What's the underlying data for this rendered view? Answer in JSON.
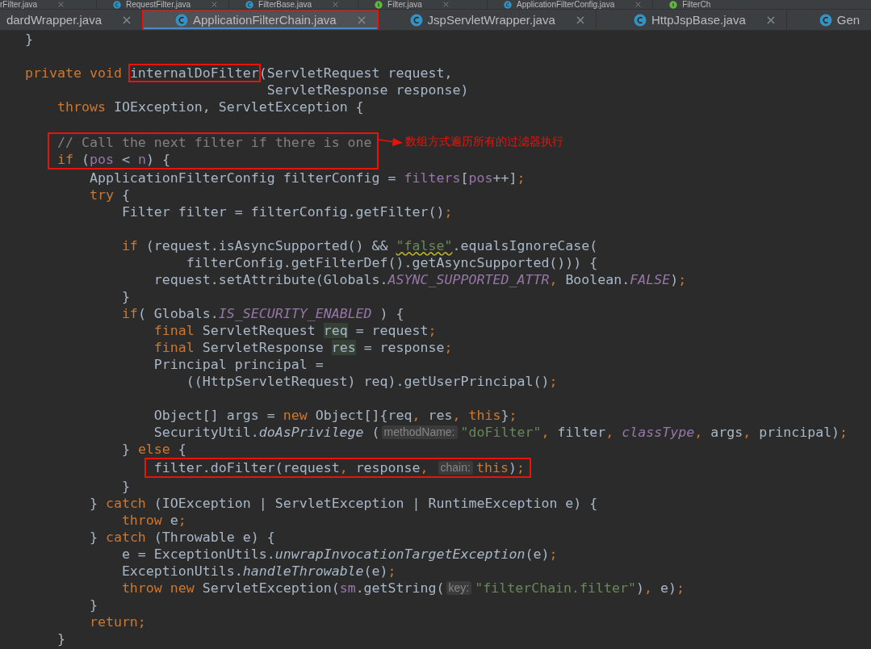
{
  "tab_rows": [
    {
      "tabs": [
        {
          "label": "rFilter.java",
          "kind": "plain",
          "closable": true,
          "selected": false,
          "boxed": false
        },
        {
          "label": "RequestFilter.java",
          "kind": "class",
          "closable": true,
          "selected": false,
          "boxed": false
        },
        {
          "label": "FilterBase.java",
          "kind": "class",
          "closable": true,
          "selected": false,
          "boxed": false
        },
        {
          "label": "Filter.java",
          "kind": "interface",
          "closable": true,
          "selected": false,
          "boxed": false
        },
        {
          "label": "ApplicationFilterConfig.java",
          "kind": "class",
          "closable": true,
          "selected": false,
          "boxed": false
        },
        {
          "label": "FilterCh",
          "kind": "interface",
          "closable": false,
          "selected": false,
          "boxed": false
        }
      ]
    },
    {
      "tabs": [
        {
          "label": "dardWrapper.java",
          "kind": "plain",
          "closable": true,
          "selected": false,
          "boxed": false
        },
        {
          "label": "ApplicationFilterChain.java",
          "kind": "class",
          "closable": true,
          "selected": true,
          "boxed": true
        },
        {
          "label": "JspServletWrapper.java",
          "kind": "class",
          "closable": true,
          "selected": false,
          "boxed": false
        },
        {
          "label": "HttpJspBase.java",
          "kind": "class",
          "closable": true,
          "selected": false,
          "boxed": false
        },
        {
          "label": "Gen",
          "kind": "class",
          "closable": false,
          "selected": false,
          "boxed": false
        }
      ]
    }
  ],
  "code": [
    {
      "kind": "code",
      "boxed": false,
      "tokens": [
        {
          "kind": "plain",
          "text": "}"
        }
      ]
    },
    {
      "kind": "blank"
    },
    {
      "kind": "code",
      "boxed": false,
      "tokens": [
        {
          "kind": "kw",
          "text": "private void "
        },
        {
          "kind": "plain",
          "text": "internalDoFilter",
          "boxed": true
        },
        {
          "kind": "plain",
          "text": "(ServletRequest request,"
        }
      ]
    },
    {
      "kind": "code",
      "boxed": false,
      "tokens": [
        {
          "kind": "plain",
          "text": "                              ServletResponse response)"
        }
      ]
    },
    {
      "kind": "code",
      "boxed": false,
      "tokens": [
        {
          "kind": "kw",
          "text": "    throws "
        },
        {
          "kind": "plain",
          "text": "IOException, ServletException {"
        }
      ]
    },
    {
      "kind": "blank"
    },
    {
      "kind": "code",
      "boxed": true,
      "note": "数组方式遍历所有的过滤器执行",
      "tokens": [
        {
          "kind": "comment",
          "text": "    // Call the next filter if there is one"
        }
      ]
    },
    {
      "kind": "code",
      "boxed": true,
      "tokens": [
        {
          "kind": "kw",
          "text": "    if "
        },
        {
          "kind": "plain",
          "text": "("
        },
        {
          "kind": "field",
          "text": "pos"
        },
        {
          "kind": "plain",
          "text": " < "
        },
        {
          "kind": "field",
          "text": "n"
        },
        {
          "kind": "plain",
          "text": ") {"
        }
      ]
    },
    {
      "kind": "code",
      "boxed": false,
      "tokens": [
        {
          "kind": "plain",
          "text": "        ApplicationFilterConfig filterConfig = "
        },
        {
          "kind": "field",
          "text": "filters"
        },
        {
          "kind": "plain",
          "text": "["
        },
        {
          "kind": "field",
          "text": "pos"
        },
        {
          "kind": "plain",
          "text": "++]"
        },
        {
          "kind": "kw",
          "text": ";"
        }
      ]
    },
    {
      "kind": "code",
      "boxed": false,
      "tokens": [
        {
          "kind": "kw",
          "text": "        try "
        },
        {
          "kind": "plain",
          "text": "{"
        }
      ]
    },
    {
      "kind": "code",
      "boxed": false,
      "tokens": [
        {
          "kind": "plain",
          "text": "            Filter filter = filterConfig.getFilter()"
        },
        {
          "kind": "kw",
          "text": ";"
        }
      ]
    },
    {
      "kind": "blank"
    },
    {
      "kind": "code",
      "boxed": false,
      "tokens": [
        {
          "kind": "kw",
          "text": "            if "
        },
        {
          "kind": "plain",
          "text": "(request.isAsyncSupported() && "
        },
        {
          "kind": "string-warn",
          "text": "\"false\""
        },
        {
          "kind": "plain",
          "text": ".equalsIgnoreCase("
        }
      ]
    },
    {
      "kind": "code",
      "boxed": false,
      "tokens": [
        {
          "kind": "plain",
          "text": "                    filterConfig.getFilterDef().getAsyncSupported())) {"
        }
      ]
    },
    {
      "kind": "code",
      "boxed": false,
      "tokens": [
        {
          "kind": "plain",
          "text": "                request.setAttribute(Globals."
        },
        {
          "kind": "static-field",
          "text": "ASYNC_SUPPORTED_ATTR"
        },
        {
          "kind": "kw",
          "text": ", "
        },
        {
          "kind": "plain",
          "text": "Boolean."
        },
        {
          "kind": "static-field",
          "text": "FALSE"
        },
        {
          "kind": "plain",
          "text": ")"
        },
        {
          "kind": "kw",
          "text": ";"
        }
      ]
    },
    {
      "kind": "code",
      "boxed": false,
      "tokens": [
        {
          "kind": "plain",
          "text": "            }"
        }
      ]
    },
    {
      "kind": "code",
      "boxed": false,
      "tokens": [
        {
          "kind": "kw",
          "text": "            if"
        },
        {
          "kind": "plain",
          "text": "( Globals."
        },
        {
          "kind": "static-field",
          "text": "IS_SECURITY_ENABLED"
        },
        {
          "kind": "plain",
          "text": " ) {"
        }
      ]
    },
    {
      "kind": "code",
      "boxed": false,
      "tokens": [
        {
          "kind": "kw",
          "text": "                final "
        },
        {
          "kind": "plain",
          "text": "ServletRequest "
        },
        {
          "kind": "usage",
          "text": "req"
        },
        {
          "kind": "plain",
          "text": " = request"
        },
        {
          "kind": "kw",
          "text": ";"
        }
      ]
    },
    {
      "kind": "code",
      "boxed": false,
      "tokens": [
        {
          "kind": "kw",
          "text": "                final "
        },
        {
          "kind": "plain",
          "text": "ServletResponse "
        },
        {
          "kind": "usage",
          "text": "res"
        },
        {
          "kind": "plain",
          "text": " = response"
        },
        {
          "kind": "kw",
          "text": ";"
        }
      ]
    },
    {
      "kind": "code",
      "boxed": false,
      "tokens": [
        {
          "kind": "plain",
          "text": "                Principal principal ="
        }
      ]
    },
    {
      "kind": "code",
      "boxed": false,
      "tokens": [
        {
          "kind": "plain",
          "text": "                    ((HttpServletRequest) req).getUserPrincipal()"
        },
        {
          "kind": "kw",
          "text": ";"
        }
      ]
    },
    {
      "kind": "blank"
    },
    {
      "kind": "code",
      "boxed": false,
      "tokens": [
        {
          "kind": "plain",
          "text": "                Object[] args = "
        },
        {
          "kind": "kw",
          "text": "new "
        },
        {
          "kind": "plain",
          "text": "Object[]{req"
        },
        {
          "kind": "kw",
          "text": ", "
        },
        {
          "kind": "plain",
          "text": "res"
        },
        {
          "kind": "kw",
          "text": ", this"
        },
        {
          "kind": "plain",
          "text": "}"
        },
        {
          "kind": "kw",
          "text": ";"
        }
      ]
    },
    {
      "kind": "code",
      "boxed": false,
      "tokens": [
        {
          "kind": "plain",
          "text": "                SecurityUtil."
        },
        {
          "kind": "static-call",
          "text": "doAsPrivilege"
        },
        {
          "kind": "plain",
          "text": " ("
        },
        {
          "kind": "hint",
          "text": "methodName:"
        },
        {
          "kind": "string",
          "text": "\"doFilter\""
        },
        {
          "kind": "kw",
          "text": ", "
        },
        {
          "kind": "plain",
          "text": "filter"
        },
        {
          "kind": "kw",
          "text": ", "
        },
        {
          "kind": "static-field",
          "text": "classType"
        },
        {
          "kind": "kw",
          "text": ", "
        },
        {
          "kind": "plain",
          "text": "args"
        },
        {
          "kind": "kw",
          "text": ", "
        },
        {
          "kind": "plain",
          "text": "principal)"
        },
        {
          "kind": "kw",
          "text": ";"
        }
      ]
    },
    {
      "kind": "code",
      "boxed": false,
      "tokens": [
        {
          "kind": "plain",
          "text": "            } "
        },
        {
          "kind": "kw",
          "text": "else "
        },
        {
          "kind": "plain",
          "text": "{"
        }
      ]
    },
    {
      "kind": "code",
      "boxed": true,
      "tokens": [
        {
          "kind": "plain",
          "text": "                filter.doFilter(request"
        },
        {
          "kind": "kw",
          "text": ", "
        },
        {
          "kind": "plain",
          "text": "response"
        },
        {
          "kind": "kw",
          "text": ", "
        },
        {
          "kind": "hint",
          "text": "chain:"
        },
        {
          "kind": "kw",
          "text": "this"
        },
        {
          "kind": "plain",
          "text": ")"
        },
        {
          "kind": "kw",
          "text": ";"
        }
      ]
    },
    {
      "kind": "code",
      "boxed": false,
      "tokens": [
        {
          "kind": "plain",
          "text": "            }"
        }
      ]
    },
    {
      "kind": "code",
      "boxed": false,
      "tokens": [
        {
          "kind": "plain",
          "text": "        } "
        },
        {
          "kind": "kw",
          "text": "catch "
        },
        {
          "kind": "plain",
          "text": "(IOException | ServletException | RuntimeException e) {"
        }
      ]
    },
    {
      "kind": "code",
      "boxed": false,
      "tokens": [
        {
          "kind": "kw",
          "text": "            throw "
        },
        {
          "kind": "plain",
          "text": "e"
        },
        {
          "kind": "kw",
          "text": ";"
        }
      ]
    },
    {
      "kind": "code",
      "boxed": false,
      "tokens": [
        {
          "kind": "plain",
          "text": "        } "
        },
        {
          "kind": "kw",
          "text": "catch "
        },
        {
          "kind": "plain",
          "text": "(Throwable e) {"
        }
      ]
    },
    {
      "kind": "code",
      "boxed": false,
      "tokens": [
        {
          "kind": "plain",
          "text": "            e = ExceptionUtils."
        },
        {
          "kind": "static-call",
          "text": "unwrapInvocationTargetException"
        },
        {
          "kind": "plain",
          "text": "(e)"
        },
        {
          "kind": "kw",
          "text": ";"
        }
      ]
    },
    {
      "kind": "code",
      "boxed": false,
      "tokens": [
        {
          "kind": "plain",
          "text": "            ExceptionUtils."
        },
        {
          "kind": "static-call",
          "text": "handleThrowable"
        },
        {
          "kind": "plain",
          "text": "(e)"
        },
        {
          "kind": "kw",
          "text": ";"
        }
      ]
    },
    {
      "kind": "code",
      "boxed": false,
      "tokens": [
        {
          "kind": "kw",
          "text": "            throw new "
        },
        {
          "kind": "plain",
          "text": "ServletException("
        },
        {
          "kind": "field",
          "text": "sm"
        },
        {
          "kind": "plain",
          "text": ".getString("
        },
        {
          "kind": "hint",
          "text": "key:"
        },
        {
          "kind": "string",
          "text": "\"filterChain.filter\""
        },
        {
          "kind": "plain",
          "text": ")"
        },
        {
          "kind": "kw",
          "text": ", "
        },
        {
          "kind": "plain",
          "text": "e)"
        },
        {
          "kind": "kw",
          "text": ";"
        }
      ]
    },
    {
      "kind": "code",
      "boxed": false,
      "tokens": [
        {
          "kind": "plain",
          "text": "        }"
        }
      ]
    },
    {
      "kind": "code",
      "boxed": false,
      "tokens": [
        {
          "kind": "kw",
          "text": "        return;"
        }
      ]
    },
    {
      "kind": "code",
      "boxed": false,
      "tokens": [
        {
          "kind": "plain",
          "text": "    }"
        }
      ]
    }
  ]
}
